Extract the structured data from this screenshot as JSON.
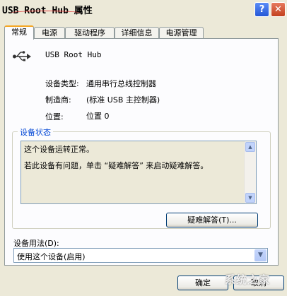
{
  "window": {
    "title": "USB Root Hub 属性",
    "help_glyph": "?",
    "close_glyph": "✕"
  },
  "tabs": [
    {
      "label": "常规",
      "active": true
    },
    {
      "label": "电源"
    },
    {
      "label": "驱动程序"
    },
    {
      "label": "详细信息"
    },
    {
      "label": "电源管理"
    }
  ],
  "device": {
    "name": "USB Root Hub",
    "icon": "usb-icon",
    "type_label": "设备类型:",
    "type_value": "通用串行总线控制器",
    "maker_label": "制造商:",
    "maker_value": "(标准 USB 主控制器)",
    "location_label": "位置:",
    "location_value": "位置 0"
  },
  "status": {
    "group_title": "设备状态",
    "line1": "这个设备运转正常。",
    "line2": "若此设备有问题，单击 “疑难解答” 来启动疑难解答。",
    "troubleshoot_label": "疑难解答(T)..."
  },
  "usage": {
    "label": "设备用法(D):",
    "selected": "使用这个设备(启用)"
  },
  "footer": {
    "ok_label": "确定",
    "cancel_label": "取消",
    "watermark": "系统之家"
  },
  "colors": {
    "accent": "#0046d5",
    "tab_highlight": "#f5a623",
    "background": "#ece9d8"
  }
}
